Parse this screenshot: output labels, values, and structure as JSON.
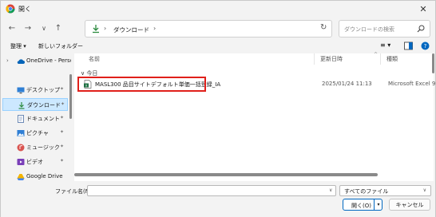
{
  "window": {
    "title": "開く",
    "close_glyph": "✕"
  },
  "nav": {
    "back_glyph": "←",
    "forward_glyph": "→",
    "recent_glyph": "∨",
    "up_glyph": "↑"
  },
  "address": {
    "sep1": "›",
    "path": "ダウンロード",
    "sep2": "›",
    "dropdown_glyph": "∨",
    "refresh_glyph": "↻"
  },
  "search": {
    "placeholder": "ダウンロードの検索"
  },
  "commandbar": {
    "organize": "整理 ▾",
    "new_folder": "新しいフォルダー",
    "view_glyph": "≡ ▾"
  },
  "navpane": {
    "items": [
      {
        "label": "OneDrive - Perso",
        "icon": "cloud-icon"
      },
      {
        "label": "デスクトップ",
        "icon": "desktop-icon"
      },
      {
        "label": "ダウンロード",
        "icon": "download-icon"
      },
      {
        "label": "ドキュメント",
        "icon": "document-icon"
      },
      {
        "label": "ピクチャ",
        "icon": "picture-icon"
      },
      {
        "label": "ミュージック",
        "icon": "music-icon"
      },
      {
        "label": "ビデオ",
        "icon": "video-icon"
      },
      {
        "label": "Google Drive",
        "icon": "drive-icon"
      }
    ],
    "expander": "›",
    "pin": "📌"
  },
  "filelist": {
    "columns": {
      "name": "名前",
      "modified": "更新日時",
      "type": "種類"
    },
    "sort_caret": "^",
    "group": "∨ 今日",
    "rows": [
      {
        "name": "MASL300 品目サイトデフォルト単価一括登録_IA",
        "modified": "2025/01/24 11:13",
        "type": "Microsoft Excel 9",
        "icon": "excel-csv-icon"
      }
    ]
  },
  "footer": {
    "filename_label": "ファイル名(N):",
    "filename_value": "",
    "filename_dropdown": "∨",
    "filetype": "すべてのファイル",
    "filetype_dropdown": "∨",
    "open": "開く(O)",
    "open_split": "▾",
    "cancel": "キャンセル"
  },
  "colors": {
    "highlight": "#e0201b",
    "selected_bg": "#cce8ff",
    "accent": "#0067c0"
  }
}
